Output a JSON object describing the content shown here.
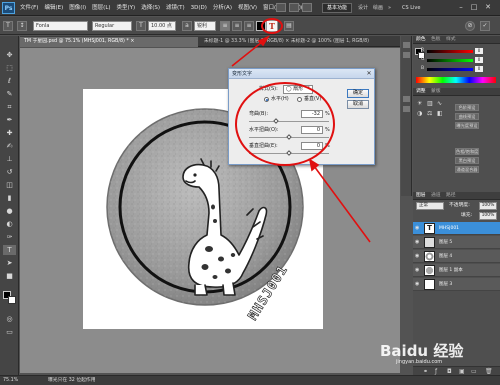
{
  "app": {
    "logo": "Ps"
  },
  "menubar": {
    "items": [
      "文件(F)",
      "编辑(E)",
      "图像(I)",
      "图层(L)",
      "类型(Y)",
      "选择(S)",
      "滤镜(T)",
      "3D(D)",
      "分析(A)",
      "视图(V)",
      "窗口(W)",
      "帮助(H)"
    ],
    "workspace_active": "基本功能",
    "workspace_items": [
      "设计",
      "绘画",
      "»"
    ],
    "cs_live": "CS Live",
    "window_buttons": [
      "–",
      "□",
      "✕"
    ]
  },
  "optionsbar": {
    "font_family": "Fonla",
    "font_style": "Regular",
    "font_size": "10.00 点",
    "aa_mode": "锐利",
    "warp_icon": "warp-text-icon"
  },
  "tabs": [
    {
      "label": "TM 于星园.psd @ 75.1% (MHSJ001, RGB/8) * ×",
      "active": true
    },
    {
      "label": "未标题-1 @ 33.3% (图层 1, RGB/8) × 未标题-2 @ 100% (图层 1, RGB/8)",
      "active": false
    }
  ],
  "dialog": {
    "title": "变形文字",
    "style_label": "样式(S):",
    "style_value": "◯ 扇形",
    "horizontal_label": "水平(H)",
    "vertical_label": "垂直(V)",
    "bend_label": "弯曲(B):",
    "bend_value": "-32",
    "hdist_label": "水平扭曲(O):",
    "hdist_value": "0",
    "vdist_label": "垂直扭曲(E):",
    "vdist_value": "0",
    "percent": "%",
    "ok_label": "确定",
    "cancel_label": "取消",
    "close": "✕"
  },
  "coin": {
    "stamp_text": "MHSJ001"
  },
  "panels": {
    "color_tabs": [
      "颜色",
      "色板",
      "样式"
    ],
    "rgb": [
      {
        "channel": "R",
        "value": "0"
      },
      {
        "channel": "G",
        "value": "0"
      },
      {
        "channel": "B",
        "value": "0"
      }
    ],
    "adjust_tabs": [
      "调整",
      "蒙版"
    ],
    "adjust_buttons": [
      "色阶预设",
      "曲线预设",
      "曝光度预设",
      "色相/饱和度",
      "黑白预设",
      "通道混合器"
    ],
    "layers_tabs": [
      "图层",
      "通道",
      "路径"
    ],
    "blend_mode": "正常",
    "opacity_label": "不透明度:",
    "opacity_value": "100%",
    "fill_label": "填充:",
    "fill_value": "100%",
    "layers": [
      {
        "name": "MHSJ001",
        "selected": true,
        "thumb": "T"
      },
      {
        "name": "图层 5",
        "selected": false,
        "thumb": ""
      },
      {
        "name": "图层 4",
        "selected": false,
        "thumb": ""
      },
      {
        "name": "图层 1 副本",
        "selected": false,
        "thumb": ""
      },
      {
        "name": "图层 3",
        "selected": false,
        "thumb": ""
      }
    ]
  },
  "status": {
    "zoom": "75.1%",
    "doc_info": "曝光只在 32 位起作用",
    "watermark": "Baidu 经验",
    "watermark_sub": "jingyan.baidu.com"
  },
  "colors": {
    "annotation_red": "#e01010",
    "selected_layer": "#3b8fd9"
  }
}
